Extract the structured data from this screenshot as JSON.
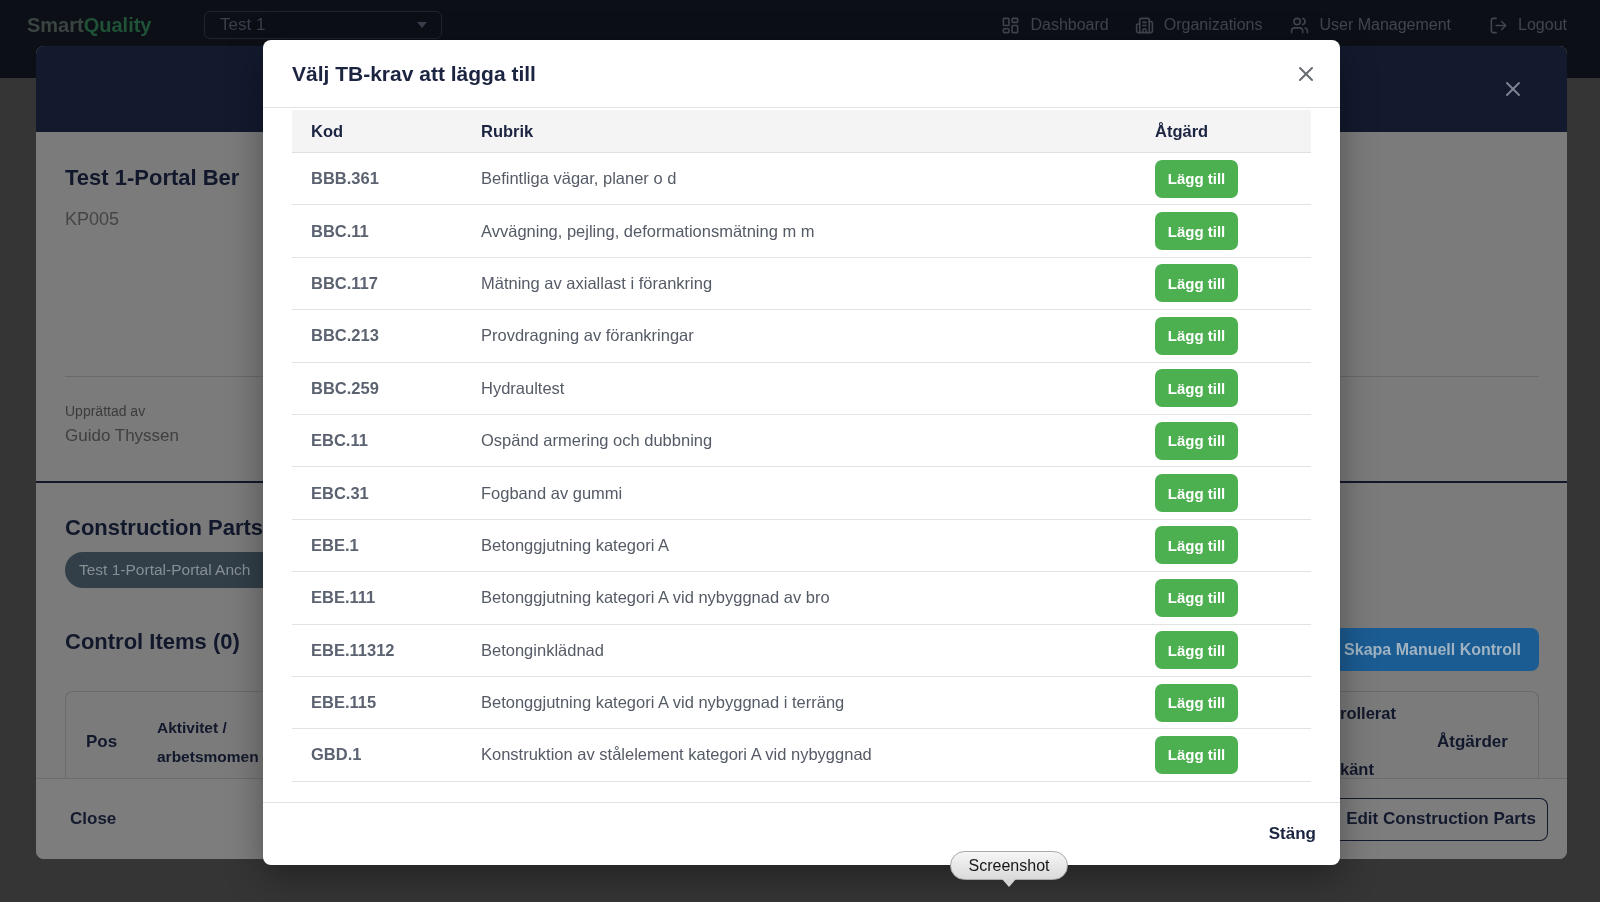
{
  "app_header": {
    "logo": {
      "primary": "Smart",
      "accent": "Quality"
    },
    "project_select": {
      "value": "Test 1"
    },
    "nav": [
      {
        "kind": "dashboard",
        "label": "Dashboard"
      },
      {
        "kind": "organizations",
        "label": "Organizations"
      },
      {
        "kind": "users",
        "label": "User Management"
      },
      {
        "kind": "logout",
        "label": "Logout"
      }
    ]
  },
  "background_dialog": {
    "title": "Test 1-Portal Ber",
    "code": "KP005",
    "created_by": {
      "label": "Upprättad av",
      "value": "Guido Thyssen"
    },
    "construction_parts": {
      "heading": "Construction Parts",
      "tags": [
        "Test 1-Portal-Portal Anch"
      ]
    },
    "control_items": {
      "heading": "Control Items (0)",
      "create_button": "Skapa Manuell Kontroll",
      "columns": {
        "pos": "Pos",
        "activity": "Aktivitet / arbetsmomen",
        "column_3": [
          "rollerat",
          "känt"
        ],
        "actions": "Åtgärder"
      }
    },
    "footer": {
      "close": "Close",
      "edit_button": "Edit Construction Parts"
    }
  },
  "dialog": {
    "title": "Välj TB-krav att lägga till",
    "columns": [
      "Kod",
      "Rubrik",
      "Åtgärd"
    ],
    "rows": [
      {
        "code": "BBB.361",
        "heading": "Befintliga vägar, planer o d",
        "action": "Lägg till"
      },
      {
        "code": "BBC.11",
        "heading": "Avvägning, pejling, deformationsmätning m m",
        "action": "Lägg till"
      },
      {
        "code": "BBC.117",
        "heading": "Mätning av axiallast i förankring",
        "action": "Lägg till"
      },
      {
        "code": "BBC.213",
        "heading": "Provdragning av förankringar",
        "action": "Lägg till"
      },
      {
        "code": "BBC.259",
        "heading": "Hydraultest",
        "action": "Lägg till"
      },
      {
        "code": "EBC.11",
        "heading": "Ospänd armering och dubbning",
        "action": "Lägg till"
      },
      {
        "code": "EBC.31",
        "heading": "Fogband av gummi",
        "action": "Lägg till"
      },
      {
        "code": "EBE.1",
        "heading": "Betonggjutning kategori A",
        "action": "Lägg till"
      },
      {
        "code": "EBE.111",
        "heading": "Betonggjutning kategori A vid nybyggnad av bro",
        "action": "Lägg till"
      },
      {
        "code": "EBE.11312",
        "heading": "Betonginklädnad",
        "action": "Lägg till"
      },
      {
        "code": "EBE.115",
        "heading": "Betonggjutning kategori A vid nybyggnad i terräng",
        "action": "Lägg till"
      },
      {
        "code": "GBD.1",
        "heading": "Konstruktion av stålelement kategori A vid nybyggnad",
        "action": "Lägg till"
      }
    ],
    "close_button": "Stäng"
  },
  "tooltip": {
    "text": "Screenshot"
  }
}
